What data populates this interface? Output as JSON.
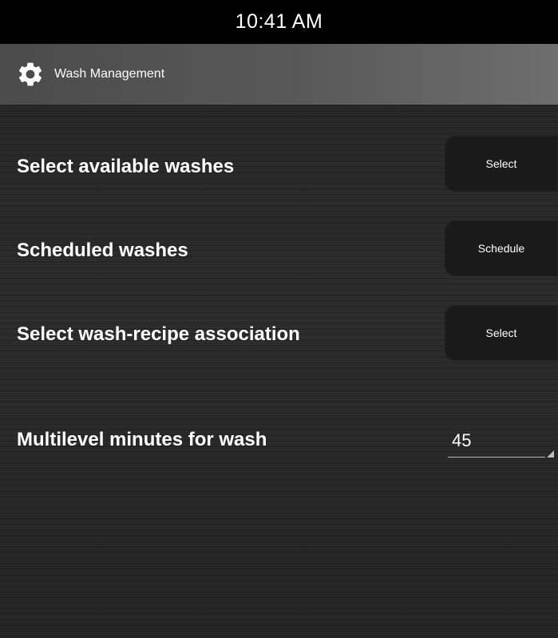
{
  "status_bar": {
    "time": "10:41 AM"
  },
  "app_bar": {
    "icon": "gear-icon",
    "title": "Wash Management"
  },
  "rows": [
    {
      "label": "Select available washes",
      "button_label": "Select"
    },
    {
      "label": "Scheduled washes",
      "button_label": "Schedule"
    },
    {
      "label": "Select wash-recipe association",
      "button_label": "Select"
    }
  ],
  "multilevel": {
    "label": "Multilevel minutes for wash",
    "value": "45"
  },
  "colors": {
    "status_bar_bg": "#000000",
    "app_bar_bg": "#595959",
    "content_bg": "#262626",
    "button_bg": "#1a1a1a",
    "text": "#ffffff"
  }
}
